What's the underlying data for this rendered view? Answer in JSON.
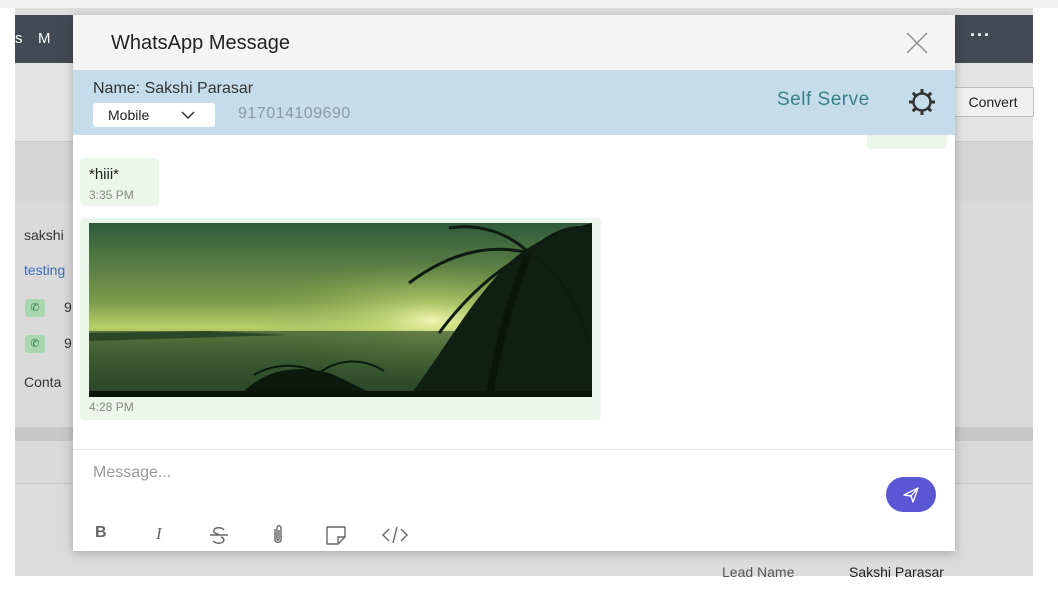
{
  "background": {
    "nav_items": [
      "s",
      "M"
    ],
    "more_label": "···",
    "convert_label": "Convert",
    "contact_lines": [
      "sakshi",
      "testing",
      "9",
      "9",
      "Conta"
    ],
    "lead_label": "Lead Name",
    "lead_value": "Sakshi Parasar"
  },
  "modal": {
    "title": "WhatsApp Message",
    "contact_name": "Name: Sakshi Parasar",
    "number_type": "Mobile",
    "phone_number": "917014109690",
    "self_serve_label": "Self Serve"
  },
  "messages": [
    {
      "type": "text",
      "text": "*hiii*",
      "time": "3:35 PM"
    },
    {
      "type": "image",
      "time": "4:28 PM"
    }
  ],
  "composer": {
    "placeholder": "Message...",
    "format_bold": "B",
    "format_italic": "I"
  },
  "colors": {
    "nav_bg": "#424a55",
    "contact_bar_bg": "#c5ddea",
    "bubble_bg": "#ebf7ea",
    "send_button": "#5b57d4",
    "self_serve_text": "#3b7f8a"
  },
  "icons": {
    "close": "close-icon",
    "chevron": "chevron-down-icon",
    "gear": "gear-icon",
    "send": "send-icon",
    "strikethrough": "strikethrough-icon",
    "attachment": "paperclip-icon",
    "note": "note-icon",
    "code": "code-icon"
  }
}
